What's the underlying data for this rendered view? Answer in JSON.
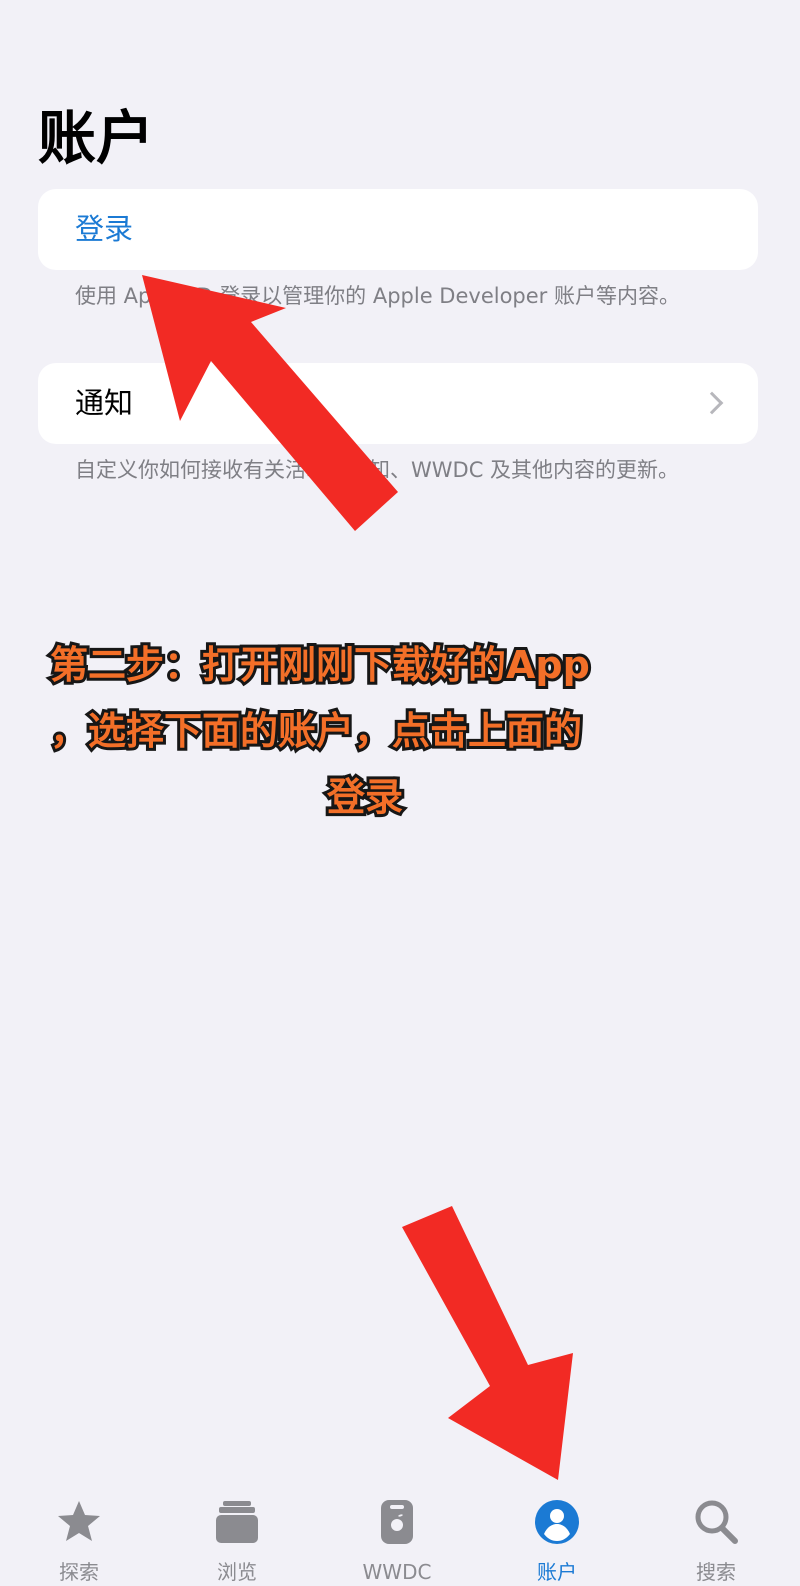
{
  "status_bar": {
    "fragment": "··"
  },
  "page": {
    "title": "账户"
  },
  "sections": {
    "signin": {
      "label": "登录",
      "footnote": "使用 Apple ID 登录以管理你的 Apple Developer 账户等内容。"
    },
    "notifications": {
      "label": "通知",
      "footnote": "自定义你如何接收有关活动的通知、WWDC 及其他内容的更新。",
      "chevron_icon": "chevron-right-icon"
    }
  },
  "overlay": {
    "instruction_line_1": "第二步：打开刚刚下载好的App",
    "instruction_line_2": "，选择下面的账户，点击上面的",
    "instruction_line_3": "登录",
    "arrow_color": "#f22a24",
    "text_color": "#f36f28",
    "text_outline_color": "#171717"
  },
  "tab_bar": {
    "selected": "账户",
    "items": [
      {
        "label": "探索",
        "icon": "star-icon"
      },
      {
        "label": "浏览",
        "icon": "stack-icon"
      },
      {
        "label": "WWDC",
        "icon": "wwdc-icon"
      },
      {
        "label": "账户",
        "icon": "account-icon"
      },
      {
        "label": "搜索",
        "icon": "search-icon"
      }
    ]
  },
  "colors": {
    "background": "#f2f1f7",
    "card": "#ffffff",
    "accent": "#1b7ad4",
    "secondary_text": "#7f7f85",
    "inactive_tab": "#8b8b90"
  }
}
